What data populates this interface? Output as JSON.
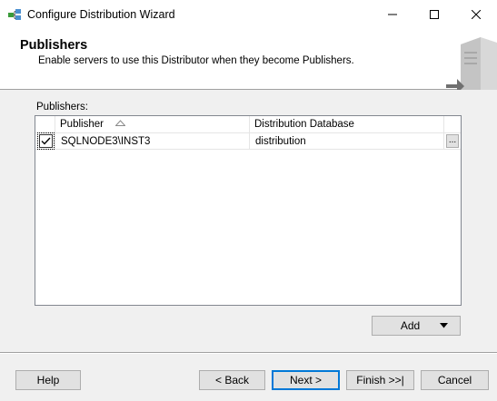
{
  "window": {
    "title": "Configure Distribution Wizard",
    "controls": {
      "minimize": "minimize-icon",
      "maximize": "maximize-icon",
      "close": "close-icon"
    }
  },
  "header": {
    "title": "Publishers",
    "subtitle": "Enable servers to use this Distributor when they become Publishers."
  },
  "publishers_label": "Publishers:",
  "table": {
    "columns": [
      "Publisher",
      "Distribution Database"
    ],
    "sort_column": "Publisher",
    "rows": [
      {
        "checked": true,
        "publisher": "SQLNODE3\\INST3",
        "database": "distribution",
        "browse": "..."
      }
    ]
  },
  "add_button": {
    "label": "Add"
  },
  "footer": {
    "help": "Help",
    "back": "< Back",
    "next": "Next >",
    "finish": "Finish >>|",
    "cancel": "Cancel"
  }
}
